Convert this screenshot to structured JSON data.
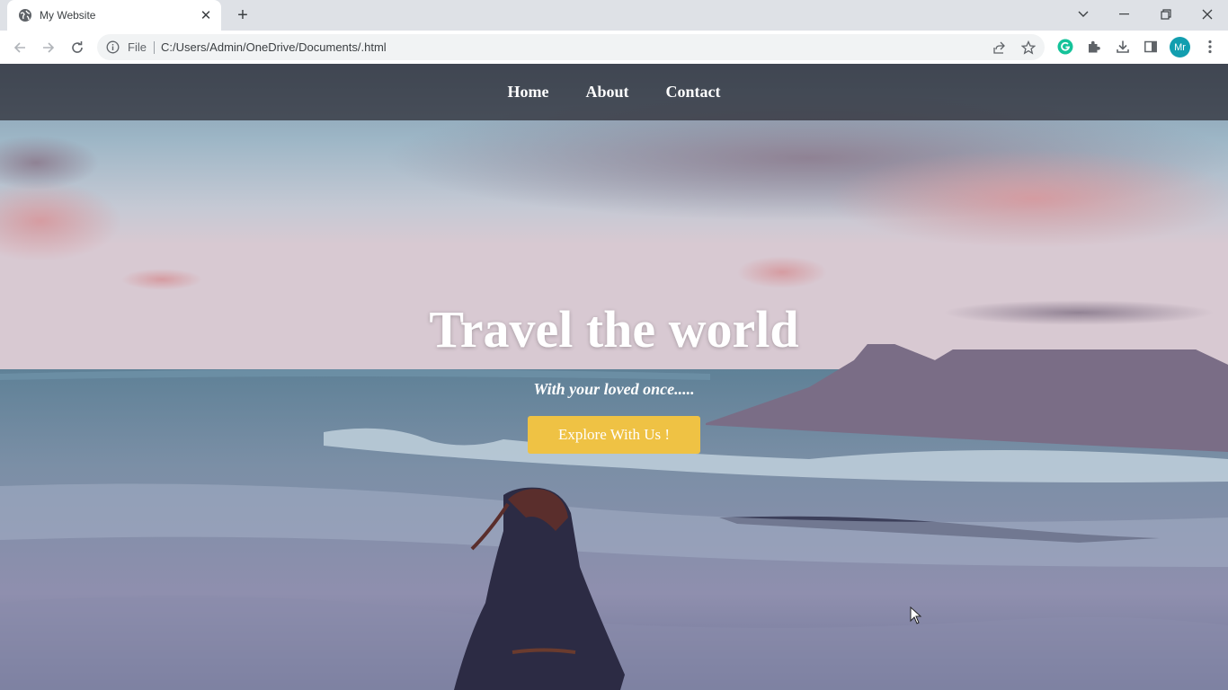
{
  "browser": {
    "tab": {
      "title": "My Website",
      "favicon": "globe-icon"
    },
    "address_bar": {
      "file_label": "File",
      "url": "C:/Users/Admin/OneDrive/Documents/.html"
    },
    "profile_initials": "Mr"
  },
  "page": {
    "nav": {
      "items": [
        {
          "label": "Home"
        },
        {
          "label": "About"
        },
        {
          "label": "Contact"
        }
      ]
    },
    "hero": {
      "title": "Travel the world",
      "subtitle": "With your loved once.....",
      "cta_label": "Explore With Us !"
    }
  },
  "colors": {
    "cta": "#efc244",
    "navbar": "#2a2a30",
    "avatar": "#129eaf",
    "grammarly": "#15c39a"
  }
}
